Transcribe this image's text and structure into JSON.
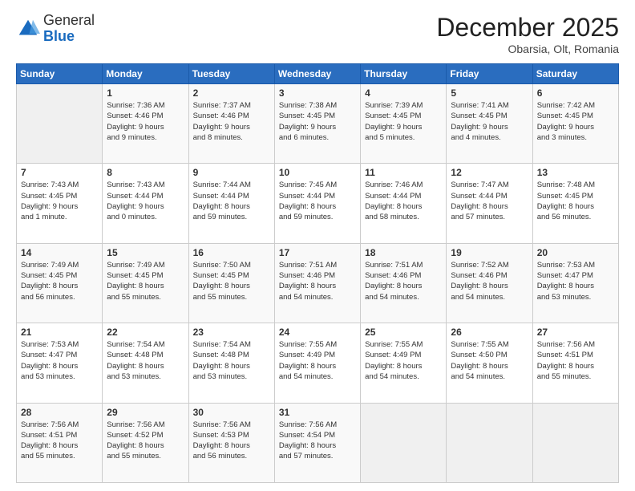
{
  "logo": {
    "general": "General",
    "blue": "Blue"
  },
  "header": {
    "month_year": "December 2025",
    "location": "Obarsia, Olt, Romania"
  },
  "weekdays": [
    "Sunday",
    "Monday",
    "Tuesday",
    "Wednesday",
    "Thursday",
    "Friday",
    "Saturday"
  ],
  "weeks": [
    [
      {
        "day": "",
        "info": ""
      },
      {
        "day": "1",
        "info": "Sunrise: 7:36 AM\nSunset: 4:46 PM\nDaylight: 9 hours\nand 9 minutes."
      },
      {
        "day": "2",
        "info": "Sunrise: 7:37 AM\nSunset: 4:46 PM\nDaylight: 9 hours\nand 8 minutes."
      },
      {
        "day": "3",
        "info": "Sunrise: 7:38 AM\nSunset: 4:45 PM\nDaylight: 9 hours\nand 6 minutes."
      },
      {
        "day": "4",
        "info": "Sunrise: 7:39 AM\nSunset: 4:45 PM\nDaylight: 9 hours\nand 5 minutes."
      },
      {
        "day": "5",
        "info": "Sunrise: 7:41 AM\nSunset: 4:45 PM\nDaylight: 9 hours\nand 4 minutes."
      },
      {
        "day": "6",
        "info": "Sunrise: 7:42 AM\nSunset: 4:45 PM\nDaylight: 9 hours\nand 3 minutes."
      }
    ],
    [
      {
        "day": "7",
        "info": "Sunrise: 7:43 AM\nSunset: 4:45 PM\nDaylight: 9 hours\nand 1 minute."
      },
      {
        "day": "8",
        "info": "Sunrise: 7:43 AM\nSunset: 4:44 PM\nDaylight: 9 hours\nand 0 minutes."
      },
      {
        "day": "9",
        "info": "Sunrise: 7:44 AM\nSunset: 4:44 PM\nDaylight: 8 hours\nand 59 minutes."
      },
      {
        "day": "10",
        "info": "Sunrise: 7:45 AM\nSunset: 4:44 PM\nDaylight: 8 hours\nand 59 minutes."
      },
      {
        "day": "11",
        "info": "Sunrise: 7:46 AM\nSunset: 4:44 PM\nDaylight: 8 hours\nand 58 minutes."
      },
      {
        "day": "12",
        "info": "Sunrise: 7:47 AM\nSunset: 4:44 PM\nDaylight: 8 hours\nand 57 minutes."
      },
      {
        "day": "13",
        "info": "Sunrise: 7:48 AM\nSunset: 4:45 PM\nDaylight: 8 hours\nand 56 minutes."
      }
    ],
    [
      {
        "day": "14",
        "info": "Sunrise: 7:49 AM\nSunset: 4:45 PM\nDaylight: 8 hours\nand 56 minutes."
      },
      {
        "day": "15",
        "info": "Sunrise: 7:49 AM\nSunset: 4:45 PM\nDaylight: 8 hours\nand 55 minutes."
      },
      {
        "day": "16",
        "info": "Sunrise: 7:50 AM\nSunset: 4:45 PM\nDaylight: 8 hours\nand 55 minutes."
      },
      {
        "day": "17",
        "info": "Sunrise: 7:51 AM\nSunset: 4:46 PM\nDaylight: 8 hours\nand 54 minutes."
      },
      {
        "day": "18",
        "info": "Sunrise: 7:51 AM\nSunset: 4:46 PM\nDaylight: 8 hours\nand 54 minutes."
      },
      {
        "day": "19",
        "info": "Sunrise: 7:52 AM\nSunset: 4:46 PM\nDaylight: 8 hours\nand 54 minutes."
      },
      {
        "day": "20",
        "info": "Sunrise: 7:53 AM\nSunset: 4:47 PM\nDaylight: 8 hours\nand 53 minutes."
      }
    ],
    [
      {
        "day": "21",
        "info": "Sunrise: 7:53 AM\nSunset: 4:47 PM\nDaylight: 8 hours\nand 53 minutes."
      },
      {
        "day": "22",
        "info": "Sunrise: 7:54 AM\nSunset: 4:48 PM\nDaylight: 8 hours\nand 53 minutes."
      },
      {
        "day": "23",
        "info": "Sunrise: 7:54 AM\nSunset: 4:48 PM\nDaylight: 8 hours\nand 53 minutes."
      },
      {
        "day": "24",
        "info": "Sunrise: 7:55 AM\nSunset: 4:49 PM\nDaylight: 8 hours\nand 54 minutes."
      },
      {
        "day": "25",
        "info": "Sunrise: 7:55 AM\nSunset: 4:49 PM\nDaylight: 8 hours\nand 54 minutes."
      },
      {
        "day": "26",
        "info": "Sunrise: 7:55 AM\nSunset: 4:50 PM\nDaylight: 8 hours\nand 54 minutes."
      },
      {
        "day": "27",
        "info": "Sunrise: 7:56 AM\nSunset: 4:51 PM\nDaylight: 8 hours\nand 55 minutes."
      }
    ],
    [
      {
        "day": "28",
        "info": "Sunrise: 7:56 AM\nSunset: 4:51 PM\nDaylight: 8 hours\nand 55 minutes."
      },
      {
        "day": "29",
        "info": "Sunrise: 7:56 AM\nSunset: 4:52 PM\nDaylight: 8 hours\nand 55 minutes."
      },
      {
        "day": "30",
        "info": "Sunrise: 7:56 AM\nSunset: 4:53 PM\nDaylight: 8 hours\nand 56 minutes."
      },
      {
        "day": "31",
        "info": "Sunrise: 7:56 AM\nSunset: 4:54 PM\nDaylight: 8 hours\nand 57 minutes."
      },
      {
        "day": "",
        "info": ""
      },
      {
        "day": "",
        "info": ""
      },
      {
        "day": "",
        "info": ""
      }
    ]
  ]
}
